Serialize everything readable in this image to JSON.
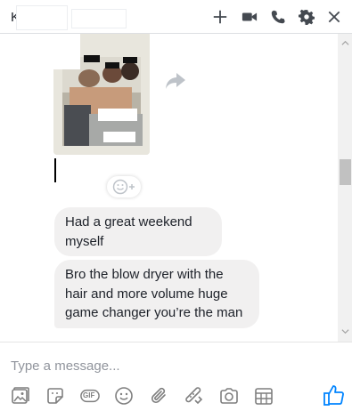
{
  "header": {
    "name_initial": "K",
    "icons": [
      "add-icon",
      "video-call-icon",
      "phone-icon",
      "gear-icon",
      "close-icon"
    ]
  },
  "thread": {
    "messages": [
      {
        "text": "Had a great weekend myself"
      },
      {
        "text": "Bro the blow dryer with the hair and more volume huge game changer you’re the man"
      }
    ]
  },
  "composer": {
    "placeholder": "Type a message...",
    "tools": [
      "photo-icon",
      "sticker-icon",
      "gif-icon",
      "emoji-icon",
      "attach-icon",
      "game-controller-icon",
      "camera-icon",
      "calendar-icon"
    ],
    "gif_label": "GIF"
  },
  "colors": {
    "accent": "#0084ff",
    "bubble": "#f1f0f0",
    "icon": "#444950"
  }
}
